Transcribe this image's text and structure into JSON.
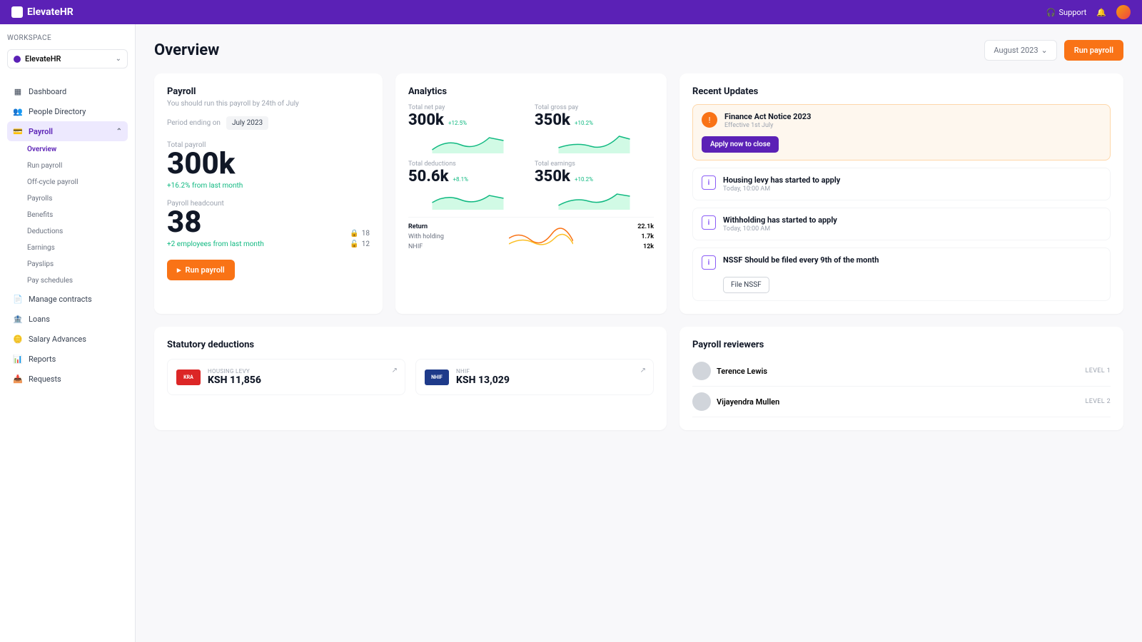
{
  "brand": "ElevateHR",
  "topbar": {
    "support": "Support"
  },
  "sidebar": {
    "section": "Workspace",
    "org": "ElevateHR",
    "items": [
      {
        "label": "Dashboard"
      },
      {
        "label": "People Directory"
      },
      {
        "label": "Payroll",
        "active": true,
        "children": [
          {
            "label": "Overview",
            "sel": true
          },
          {
            "label": "Run payroll"
          },
          {
            "label": "Off-cycle payroll"
          },
          {
            "label": "Payrolls"
          },
          {
            "label": "Benefits"
          },
          {
            "label": "Deductions"
          },
          {
            "label": "Earnings"
          },
          {
            "label": "Payslips"
          },
          {
            "label": "Pay schedules"
          }
        ]
      },
      {
        "label": "Manage contracts"
      },
      {
        "label": "Loans"
      },
      {
        "label": "Salary Advances"
      },
      {
        "label": "Reports"
      },
      {
        "label": "Requests"
      }
    ]
  },
  "page": {
    "title": "Overview",
    "period": "August 2023",
    "run_btn": "Run payroll"
  },
  "payroll": {
    "title": "Payroll",
    "subtitle": "You should run this payroll by 24th of July",
    "period_label": "Period ending on",
    "period_value": "July 2023",
    "total_label": "Total payroll",
    "total_value": "300k",
    "total_change": "+16.2% from last month",
    "headcount_label": "Payroll headcount",
    "headcount_value": "38",
    "headcount_change": "+2 employees from last month",
    "locked": "18",
    "unlocked": "12",
    "run_btn": "Run payroll"
  },
  "analytics": {
    "title": "Analytics",
    "stats": [
      {
        "label": "Total net pay",
        "value": "300k",
        "trend": "+12.5%"
      },
      {
        "label": "Total gross pay",
        "value": "350k",
        "trend": "+10.2%"
      },
      {
        "label": "Total deductions",
        "value": "50.6k",
        "trend": "+8.1%"
      },
      {
        "label": "Total earnings",
        "value": "350k",
        "trend": "+10.2%"
      }
    ],
    "returns": {
      "title": "Return",
      "rows": [
        {
          "label": "With holding",
          "value": "22.1k"
        },
        {
          "label": "NHIF",
          "value": "1.7k"
        },
        {
          "label": "",
          "value": "12k"
        }
      ]
    }
  },
  "updates": {
    "title": "Recent Updates",
    "items": [
      {
        "highlight": true,
        "title": "Finance Act Notice 2023",
        "sub": "Effective 1st July",
        "action": "Apply now to close"
      },
      {
        "title": "Housing levy has started to apply",
        "sub": "Today, 10:00 AM"
      },
      {
        "title": "Withholding has started to apply",
        "sub": "Today, 10:00 AM"
      },
      {
        "title": "NSSF Should be filed every 9th of the month",
        "sub": "",
        "action": "File NSSF"
      }
    ]
  },
  "statutory": {
    "title": "Statutory deductions",
    "cards": [
      {
        "logo": "KRA",
        "name": "HOUSING LEVY",
        "value": "KSH 11,856",
        "color": "red"
      },
      {
        "logo": "NHIF",
        "name": "NHIF",
        "value": "KSH 13,029",
        "color": "blue"
      }
    ]
  },
  "reviewers": {
    "title": "Payroll reviewers",
    "list": [
      {
        "name": "Terence Lewis",
        "level": "LEVEL 1"
      },
      {
        "name": "Vijayendra Mullen",
        "level": "LEVEL 2"
      }
    ]
  }
}
